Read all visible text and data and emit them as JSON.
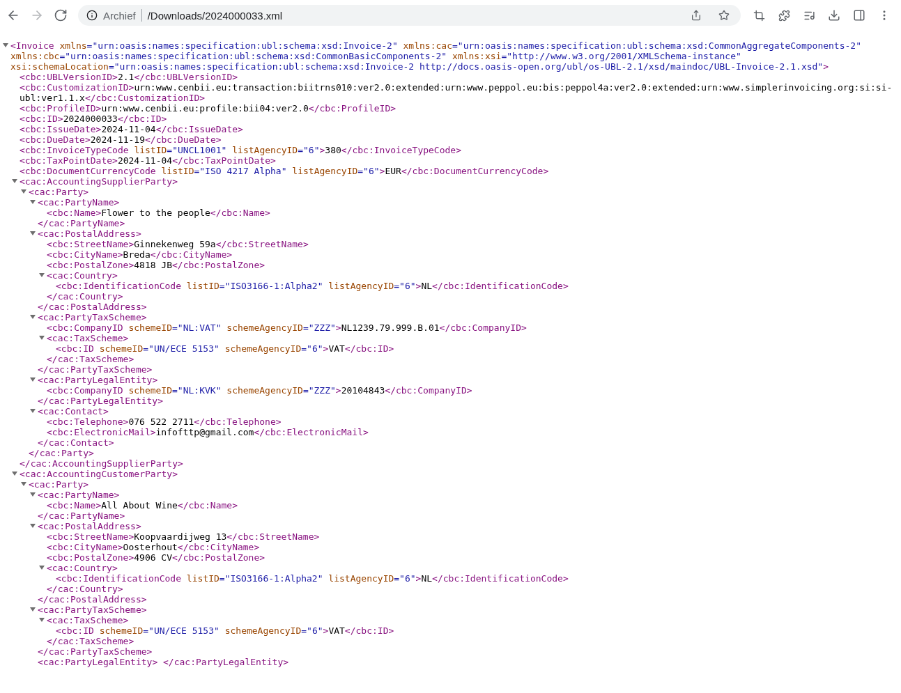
{
  "browser": {
    "nav": [
      {
        "kind": "back",
        "disabled": false
      },
      {
        "kind": "forward",
        "disabled": true
      },
      {
        "kind": "reload",
        "disabled": false
      }
    ],
    "site_label": "Archief",
    "url": "/Downloads/2024000033.xml"
  },
  "xml": [
    {
      "line": "<Invoice xmlns=\"urn:oasis:names:specification:ubl:schema:xsd:Invoice-2\" xmlns:cac=\"urn:oasis:names:specification:ubl:schema:xsd:CommonAggregateComponents-2\" xmlns:cbc=\"urn:oasis:names:specification:ubl:schema:xsd:CommonBasicComponents-2\" xmlns:xsi=\"http://www.w3.org/2001/XMLSchema-instance\" xsi:schemaLocation=\"urn:oasis:names:specification:ubl:schema:xsd:Invoice-2 http://docs.oasis-open.org/ubl/os-UBL-2.1/xsd/maindoc/UBL-Invoice-2.1.xsd\">",
      "expanded": true,
      "children": [
        {
          "line": "<cbc:UBLVersionID>2.1</cbc:UBLVersionID>"
        },
        {
          "line": "<cbc:CustomizationID>urn:www.cenbii.eu:transaction:biitrns010:ver2.0:extended:urn:www.peppol.eu:bis:peppol4a:ver2.0:extended:urn:www.simplerinvoicing.org:si:si-ubl:ver1.1.x</cbc:CustomizationID>"
        },
        {
          "line": "<cbc:ProfileID>urn:www.cenbii.eu:profile:bii04:ver2.0</cbc:ProfileID>"
        },
        {
          "line": "<cbc:ID>2024000033</cbc:ID>"
        },
        {
          "line": "<cbc:IssueDate>2024-11-04</cbc:IssueDate>"
        },
        {
          "line": "<cbc:DueDate>2024-11-19</cbc:DueDate>"
        },
        {
          "line": "<cbc:InvoiceTypeCode listID=\"UNCL1001\" listAgencyID=\"6\">380</cbc:InvoiceTypeCode>"
        },
        {
          "line": "<cbc:TaxPointDate>2024-11-04</cbc:TaxPointDate>"
        },
        {
          "line": "<cbc:DocumentCurrencyCode listID=\"ISO 4217 Alpha\" listAgencyID=\"6\">EUR</cbc:DocumentCurrencyCode>"
        },
        {
          "line": "<cac:AccountingSupplierParty>",
          "expanded": true,
          "close": "</cac:AccountingSupplierParty>",
          "children": [
            {
              "line": "<cac:Party>",
              "expanded": true,
              "close": "</cac:Party>",
              "children": [
                {
                  "line": "<cac:PartyName>",
                  "expanded": true,
                  "close": "</cac:PartyName>",
                  "children": [
                    {
                      "line": "<cbc:Name>Flower to the people</cbc:Name>"
                    }
                  ]
                },
                {
                  "line": "<cac:PostalAddress>",
                  "expanded": true,
                  "close": "</cac:PostalAddress>",
                  "children": [
                    {
                      "line": "<cbc:StreetName>Ginnekenweg 59a</cbc:StreetName>"
                    },
                    {
                      "line": "<cbc:CityName>Breda</cbc:CityName>"
                    },
                    {
                      "line": "<cbc:PostalZone>4818 JB</cbc:PostalZone>"
                    },
                    {
                      "line": "<cac:Country>",
                      "expanded": true,
                      "close": "</cac:Country>",
                      "children": [
                        {
                          "line": "<cbc:IdentificationCode listID=\"ISO3166-1:Alpha2\" listAgencyID=\"6\">NL</cbc:IdentificationCode>"
                        }
                      ]
                    }
                  ]
                },
                {
                  "line": "<cac:PartyTaxScheme>",
                  "expanded": true,
                  "close": "</cac:PartyTaxScheme>",
                  "children": [
                    {
                      "line": "<cbc:CompanyID schemeID=\"NL:VAT\" schemeAgencyID=\"ZZZ\">NL1239.79.999.B.01</cbc:CompanyID>"
                    },
                    {
                      "line": "<cac:TaxScheme>",
                      "expanded": true,
                      "close": "</cac:TaxScheme>",
                      "children": [
                        {
                          "line": "<cbc:ID schemeID=\"UN/ECE 5153\" schemeAgencyID=\"6\">VAT</cbc:ID>"
                        }
                      ]
                    }
                  ]
                },
                {
                  "line": "<cac:PartyLegalEntity>",
                  "expanded": true,
                  "close": "</cac:PartyLegalEntity>",
                  "children": [
                    {
                      "line": "<cbc:CompanyID schemeID=\"NL:KVK\" schemeAgencyID=\"ZZZ\">20104843</cbc:CompanyID>"
                    }
                  ]
                },
                {
                  "line": "<cac:Contact>",
                  "expanded": true,
                  "close": "</cac:Contact>",
                  "children": [
                    {
                      "line": "<cbc:Telephone>076 522 2711</cbc:Telephone>"
                    },
                    {
                      "line": "<cbc:ElectronicMail>infofttp@gmail.com</cbc:ElectronicMail>"
                    }
                  ]
                }
              ]
            }
          ]
        },
        {
          "line": "<cac:AccountingCustomerParty>",
          "expanded": true,
          "children": [
            {
              "line": "<cac:Party>",
              "expanded": true,
              "children": [
                {
                  "line": "<cac:PartyName>",
                  "expanded": true,
                  "close": "</cac:PartyName>",
                  "children": [
                    {
                      "line": "<cbc:Name>All About Wine</cbc:Name>"
                    }
                  ]
                },
                {
                  "line": "<cac:PostalAddress>",
                  "expanded": true,
                  "close": "</cac:PostalAddress>",
                  "children": [
                    {
                      "line": "<cbc:StreetName>Koopvaardijweg 13</cbc:StreetName>"
                    },
                    {
                      "line": "<cbc:CityName>Oosterhout</cbc:CityName>"
                    },
                    {
                      "line": "<cbc:PostalZone>4906 CV</cbc:PostalZone>"
                    },
                    {
                      "line": "<cac:Country>",
                      "expanded": true,
                      "close": "</cac:Country>",
                      "children": [
                        {
                          "line": "<cbc:IdentificationCode listID=\"ISO3166-1:Alpha2\" listAgencyID=\"6\">NL</cbc:IdentificationCode>"
                        }
                      ]
                    }
                  ]
                },
                {
                  "line": "<cac:PartyTaxScheme>",
                  "expanded": true,
                  "close": "</cac:PartyTaxScheme>",
                  "children": [
                    {
                      "line": "<cac:TaxScheme>",
                      "expanded": true,
                      "close": "</cac:TaxScheme>",
                      "children": [
                        {
                          "line": "<cbc:ID schemeID=\"UN/ECE 5153\" schemeAgencyID=\"6\">VAT</cbc:ID>"
                        }
                      ]
                    }
                  ]
                },
                {
                  "line": "<cac:PartyLegalEntity> </cac:PartyLegalEntity>"
                }
              ]
            }
          ]
        }
      ]
    }
  ]
}
